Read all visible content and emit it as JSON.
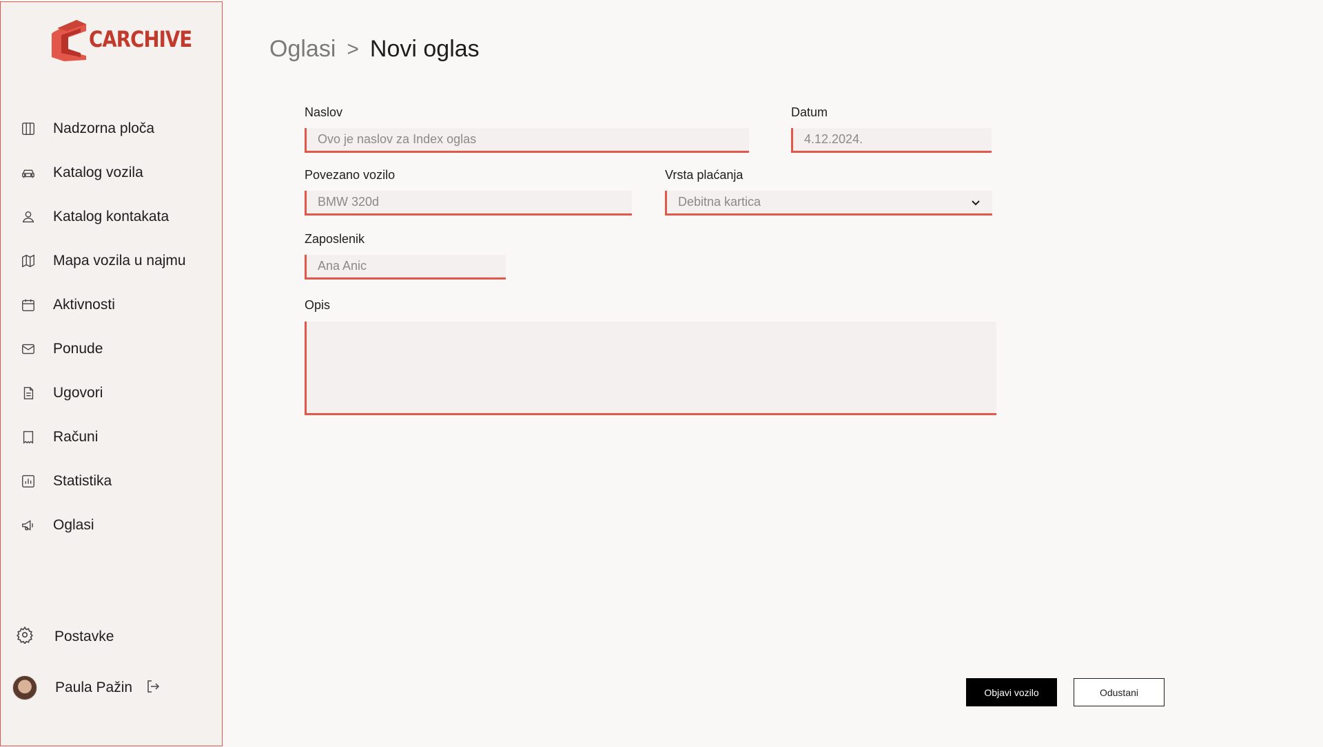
{
  "app": {
    "brand_name": "CARCHIVE"
  },
  "colors": {
    "accent": "#e3574a",
    "logo": "#c23a2c",
    "field_bg": "#f3f0ef",
    "sidebar_bg": "#f4f1ef",
    "page_bg": "#faf8f7"
  },
  "sidebar": {
    "items": [
      {
        "label": "Nadzorna ploča",
        "icon": "dashboard-icon"
      },
      {
        "label": "Katalog vozila",
        "icon": "car-icon"
      },
      {
        "label": "Katalog kontakata",
        "icon": "user-icon"
      },
      {
        "label": "Mapa vozila u najmu",
        "icon": "map-icon"
      },
      {
        "label": "Aktivnosti",
        "icon": "calendar-icon"
      },
      {
        "label": "Ponude",
        "icon": "mail-icon"
      },
      {
        "label": "Ugovori",
        "icon": "document-icon"
      },
      {
        "label": "Računi",
        "icon": "receipt-icon"
      },
      {
        "label": "Statistika",
        "icon": "chart-icon"
      },
      {
        "label": "Oglasi",
        "icon": "megaphone-icon"
      }
    ],
    "settings_label": "Postavke",
    "user_name": "Paula Pažin"
  },
  "breadcrumb": {
    "parent": "Oglasi",
    "separator": ">",
    "current": "Novi oglas"
  },
  "form": {
    "title_label": "Naslov",
    "title_placeholder": "Ovo je naslov za Index oglas",
    "date_label": "Datum",
    "date_value": "4.12.2024.",
    "vehicle_label": "Povezano vozilo",
    "vehicle_value": "BMW 320d",
    "payment_label": "Vrsta plaćanja",
    "payment_value": "Debitna kartica",
    "employee_label": "Zaposlenik",
    "employee_value": "Ana Anic",
    "description_label": "Opis"
  },
  "actions": {
    "publish_label": "Objavi vozilo",
    "cancel_label": "Odustani"
  }
}
